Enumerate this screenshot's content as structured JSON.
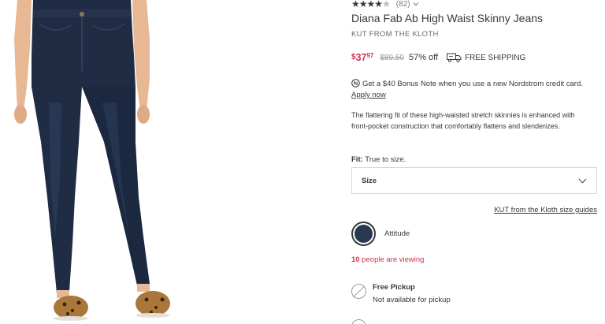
{
  "product": {
    "rating": {
      "stars_filled": 4,
      "stars_total": 5,
      "count": "(82)"
    },
    "title": "Diana Fab Ab High Waist Skinny Jeans",
    "brand": "KUT FROM THE KLOTH",
    "price": {
      "dollar_sign": "$",
      "whole": "37",
      "cents": "97",
      "original": "$89.50",
      "discount": "57% off",
      "shipping": "FREE SHIPPING"
    },
    "bonus": {
      "text": "Get a $40 Bonus Note when you use a new Nordstrom credit card.",
      "link": "Apply now"
    },
    "description": "The flattering fit of these high-waisted stretch skinnies is enhanced with front-pocket construction that comfortably flattens and slenderizes.",
    "fit": {
      "label": "Fit:",
      "value": "True to size."
    },
    "size_select": {
      "label": "Size"
    },
    "size_guide": "KUT from the Kloth size guides",
    "color": {
      "name": "Attitude",
      "swatch": "#27384f"
    },
    "viewing": {
      "count": "10",
      "text": "people are viewing"
    },
    "pickup": {
      "title": "Free Pickup",
      "status": "Not available for pickup"
    }
  },
  "colors": {
    "accent_red": "#d1344e",
    "text": "#393939",
    "denim": "#1f2c44"
  },
  "icons": [
    "star-icon",
    "chevron-down-icon",
    "truck-icon",
    "nordstrom-note-icon",
    "unavailable-icon"
  ]
}
